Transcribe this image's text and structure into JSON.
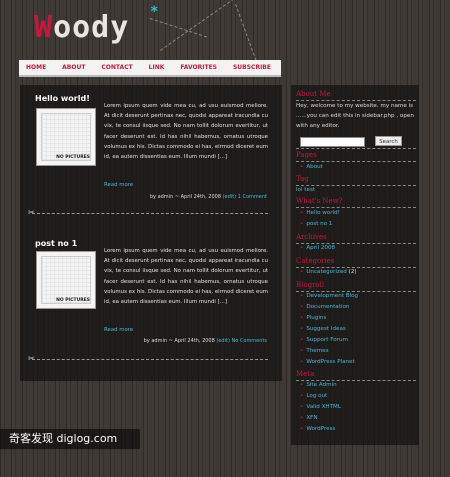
{
  "site": {
    "logo_first": "W",
    "logo_rest": "oody",
    "logo_star": "*"
  },
  "nav": [
    "HOME",
    "ABOUT",
    "CONTACT",
    "LINK",
    "FAVORITES",
    "SUBSCRIBE"
  ],
  "posts": [
    {
      "title": "Hello world!",
      "thumb_label": "NO PICTURES",
      "excerpt": "Lorem ipsum quem vide mea cu, ad usu euismod meliore. At dicit deserunt pertinax nec, quodsi appareat iracundia cu vix, te consul iisque sed. No nam tollit dolorum evertitur, ut facer deserunt est. Id has nihil habemus, ornatus utroque volumus ex his. Dictas commodo ei has, eirmod diceret eum id, ea autem dissentias eum. Illum mundi [...]",
      "read_more": "Read more",
      "meta_prefix": "by admin ~ April 24th, 2008",
      "meta_edit": "(edit)",
      "meta_comments": "1 Comment"
    },
    {
      "title": "post no 1",
      "thumb_label": "NO PICTURES",
      "excerpt": "Lorem ipsum quem vide mea cu, ad usu euismod meliore. At dicit deserunt pertinax nec, quodsi appareat iracundia cu vix, te consul iisque sed. No nam tollit dolorum evertitur, ut facer deserunt est. Id has nihil habemus, ornatus utroque volumus ex his. Dictas commodo ei has, eirmod diceret eum id, ea autem dissentias eum. Illum mundi [...]",
      "read_more": "Read more",
      "meta_prefix": "by admin ~ April 24th, 2008",
      "meta_edit": "(edit)",
      "meta_comments": "No Comments"
    }
  ],
  "sidebar": {
    "about_heading": "About Me",
    "about_text": "Hey, welcome to my website. my name is ......you can edit this in sidebar.php , open with any editor.",
    "search_button": "Search",
    "pages_heading": "Pages",
    "pages": [
      "About"
    ],
    "tag_heading": "Tag",
    "tag_text": "lol test",
    "whats_new_heading": "What's New?",
    "whats_new": [
      "Hello world!",
      "post no 1"
    ],
    "archives_heading": "Archives",
    "archives": [
      "April 2008"
    ],
    "categories_heading": "Categories",
    "categories": [
      {
        "label": "Uncategorized",
        "count": "(2)"
      }
    ],
    "blogroll_heading": "Blogroll",
    "blogroll": [
      "Development Blog",
      "Documentation",
      "Plugins",
      "Suggest Ideas",
      "Support Forum",
      "Themes",
      "WordPress Planet"
    ],
    "meta_heading": "Meta",
    "meta": [
      "Site Admin",
      "Log out",
      "Valid XHTML",
      "XFN",
      "WordPress"
    ]
  },
  "watermark": "奇客发现 diglog.com"
}
